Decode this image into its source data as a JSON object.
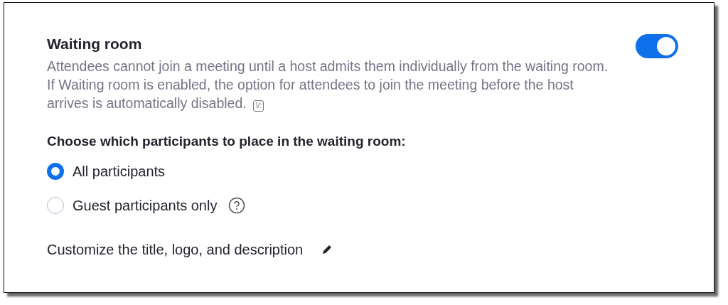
{
  "setting": {
    "title": "Waiting room",
    "on": true,
    "description": "Attendees cannot join a meeting until a host admits them individually from the waiting room. If Waiting room is enabled, the option for attendees to join the meeting before the host arrives is automatically disabled.",
    "badge": "V:"
  },
  "choice": {
    "heading": "Choose which participants to place in the waiting room:",
    "options": [
      {
        "label": "All participants",
        "selected": true,
        "help": false
      },
      {
        "label": "Guest participants only",
        "selected": false,
        "help": true
      }
    ]
  },
  "customize": {
    "label": "Customize the title, logo, and description"
  }
}
